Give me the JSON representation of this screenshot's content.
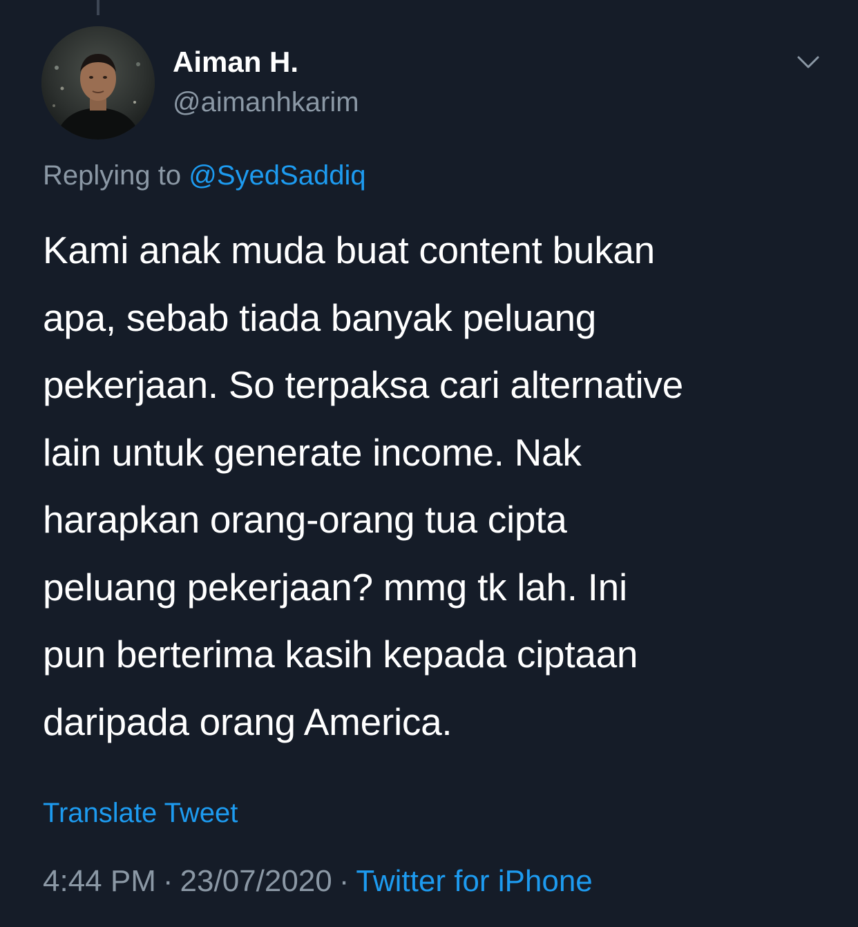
{
  "tweet": {
    "author": {
      "display_name": "Aiman H.",
      "handle": "@aimanhkarim"
    },
    "reply_prefix": "Replying to",
    "reply_to": "@SyedSaddiq",
    "text_lines": [
      "Kami anak muda buat content bukan",
      "apa, sebab tiada banyak peluang",
      "pekerjaan. So terpaksa cari alternative",
      "lain untuk generate income. Nak",
      "harapkan orang-orang tua cipta",
      "peluang pekerjaan? mmg tk lah. Ini",
      "pun berterima kasih kepada ciptaan",
      "daripada orang America."
    ],
    "translate_label": "Translate Tweet",
    "time": "4:44 PM",
    "separator": "·",
    "date": "23/07/2020",
    "source": "Twitter for iPhone"
  },
  "icons": {
    "menu": "chevron-down-icon",
    "avatar": "profile-photo"
  },
  "colors": {
    "background": "#151c28",
    "primary_text": "#ffffff",
    "secondary_text": "#8b98a5",
    "accent": "#1d9bf0"
  }
}
